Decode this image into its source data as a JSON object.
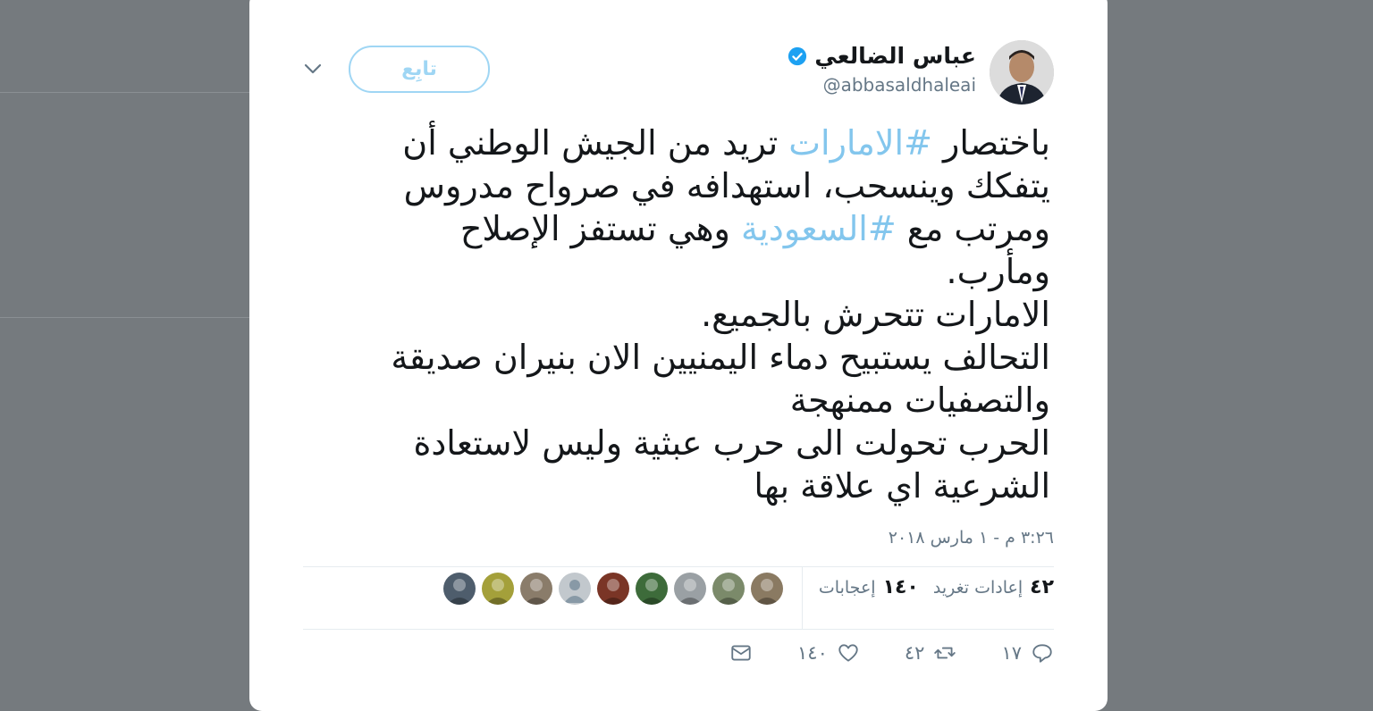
{
  "tweet": {
    "author_name": "عباس الضالعي",
    "author_handle": "@abbasaldhaleai",
    "follow_label": "تابِع",
    "lines": [
      {
        "pre": "باختصار ",
        "tag": "#الامارات",
        "post": " تريد من الجيش الوطني أن"
      },
      {
        "pre": "يتفكك وينسحب، استهدافه في صرواح مدروس",
        "tag": "",
        "post": ""
      },
      {
        "pre": "ومرتب مع ",
        "tag": "#السعودية",
        "post": " وهي تستفز الإصلاح"
      },
      {
        "pre": "ومأرب.",
        "tag": "",
        "post": ""
      },
      {
        "pre": "الامارات تتحرش بالجميع.",
        "tag": "",
        "post": ""
      },
      {
        "pre": "التحالف يستبيح دماء اليمنيين الان بنيران صديقة",
        "tag": "",
        "post": ""
      },
      {
        "pre": "والتصفيات ممنهجة",
        "tag": "",
        "post": ""
      },
      {
        "pre": "الحرب تحولت الى حرب عبثية وليس لاستعادة",
        "tag": "",
        "post": ""
      },
      {
        "pre": "الشرعية اي علاقة بها",
        "tag": "",
        "post": ""
      }
    ],
    "timestamp": "٣:٢٦ م - ١ مارس ٢٠١٨",
    "stats": {
      "retweets_count": "٤٢",
      "retweets_label": "إعادات تغريد",
      "likes_count": "١٤٠",
      "likes_label": "إعجابات"
    },
    "actions": {
      "reply_count": "١٧",
      "retweet_count": "٤٢",
      "like_count": "١٤٠"
    }
  },
  "colors": {
    "accent": "#1da1f2",
    "hashtag": "#83c6ed",
    "follow_border": "#9fd6f4",
    "text": "#14171a",
    "muted": "#657786",
    "backdrop": "#757a7e"
  },
  "likers": [
    {
      "icon": "liker-avatar-1",
      "bg": "#8a7a62"
    },
    {
      "icon": "liker-avatar-2",
      "bg": "#7b8a6a"
    },
    {
      "icon": "liker-avatar-3",
      "bg": "#9aa0a4"
    },
    {
      "icon": "liker-avatar-4",
      "bg": "#3d6b3a"
    },
    {
      "icon": "liker-avatar-5",
      "bg": "#7a3526"
    },
    {
      "icon": "default-avatar-icon",
      "bg": "#c2c8cd"
    },
    {
      "icon": "liker-avatar-7",
      "bg": "#8a7c6a"
    },
    {
      "icon": "liker-avatar-8",
      "bg": "#a4a03a"
    },
    {
      "icon": "liker-avatar-9",
      "bg": "#4e5d6c"
    }
  ]
}
